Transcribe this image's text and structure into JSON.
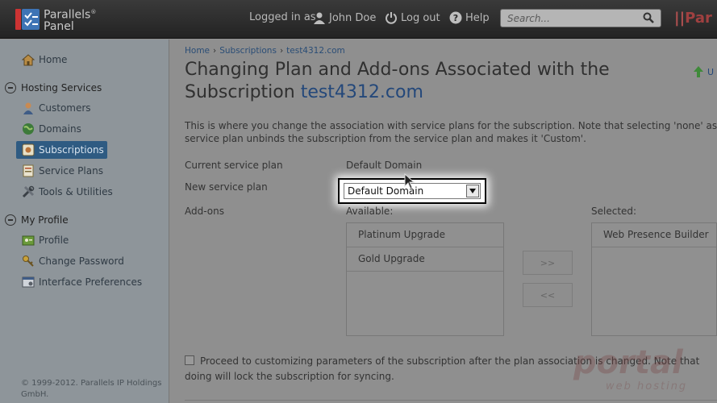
{
  "header": {
    "logo_line1": "Parallels",
    "logo_line2": "Panel",
    "logged_in_as": "Logged in as",
    "user_name": "John Doe",
    "logout": "Log out",
    "help": "Help",
    "search_placeholder": "Search...",
    "brand_right": "Par"
  },
  "sidebar": {
    "home": "Home",
    "hosting_section": "Hosting Services",
    "hosting_items": [
      "Customers",
      "Domains",
      "Subscriptions",
      "Service Plans",
      "Tools & Utilities"
    ],
    "profile_section": "My Profile",
    "profile_items": [
      "Profile",
      "Change Password",
      "Interface Preferences"
    ],
    "copyright": "© 1999-2012. Parallels IP Holdings GmbH."
  },
  "main": {
    "breadcrumbs": [
      "Home",
      "Subscriptions",
      "test4312.com"
    ],
    "title": "Changing Plan and Add-ons Associated with the Subscription ",
    "title_domain": "test4312.com",
    "up_label": "U",
    "intro_line1": "This is where you change the association with service plans for the subscription. Note that selecting 'none' as a n",
    "intro_line2": "service plan unbinds the subscription from the service plan and makes it 'Custom'.",
    "current_plan_label": "Current service plan",
    "current_plan_value": "Default Domain",
    "new_plan_label": "New service plan",
    "new_plan_selected": "Default Domain",
    "addons_label": "Add-ons",
    "available_label": "Available:",
    "selected_label": "Selected:",
    "available_addons": [
      "Platinum Upgrade",
      "Gold Upgrade"
    ],
    "selected_addons": [
      "Web Presence Builder"
    ],
    "add_button": ">>",
    "remove_button": "<<",
    "proceed_text": "Proceed to customizing parameters of the subscription after the plan association is changed. Note that doing will lock the subscription for syncing.",
    "watermark": "portal",
    "watermark_sub": "web hosting"
  }
}
